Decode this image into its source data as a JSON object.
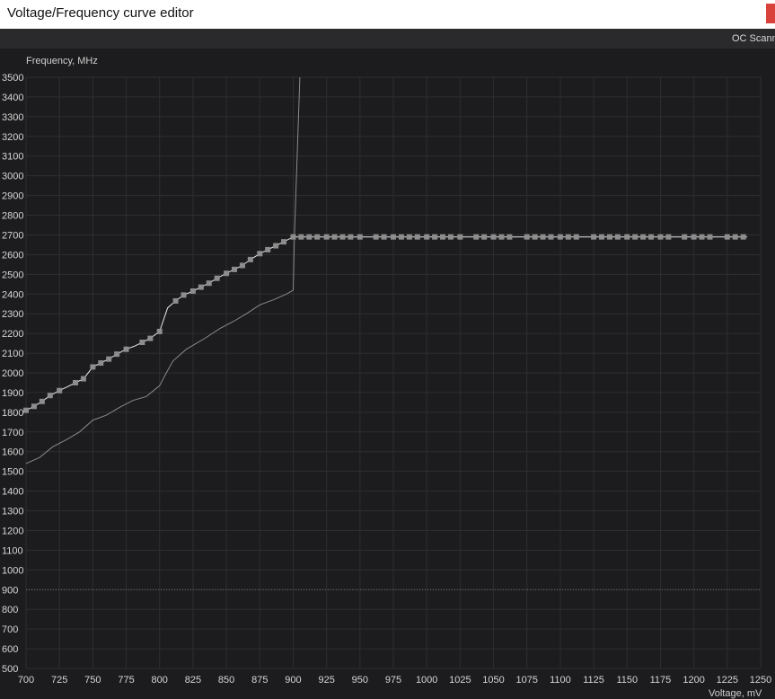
{
  "window": {
    "title": "Voltage/Frequency curve editor",
    "close_icon": "close-icon"
  },
  "toolbar": {
    "oc_scanner_label": "OC Scanner"
  },
  "colors": {
    "background": "#1c1c1e",
    "grid": "#2e2e31",
    "curve": "#e8e8e8",
    "baseline_curve": "#8a8a8a",
    "point": "#8d8d8d",
    "axis_text": "#d6d6d6",
    "close_button": "#d9423b"
  },
  "chart_data": {
    "type": "line",
    "xlabel": "Voltage, mV",
    "ylabel": "Frequency, MHz",
    "xlim": [
      700,
      1250
    ],
    "ylim": [
      500,
      3500
    ],
    "x_ticks": [
      700,
      725,
      750,
      775,
      800,
      825,
      850,
      875,
      900,
      925,
      950,
      975,
      1000,
      1025,
      1050,
      1075,
      1100,
      1125,
      1150,
      1175,
      1200,
      1225,
      1250
    ],
    "y_ticks": [
      500,
      600,
      700,
      800,
      900,
      1000,
      1100,
      1200,
      1300,
      1400,
      1500,
      1600,
      1700,
      1800,
      1900,
      2000,
      2100,
      2200,
      2300,
      2400,
      2500,
      2600,
      2700,
      2800,
      2900,
      3000,
      3100,
      3200,
      3300,
      3400,
      3500
    ],
    "grid": true,
    "reference_line_y": 900,
    "series": [
      {
        "kind": "edited_curve",
        "x": [
          700,
          706,
          712,
          718,
          725,
          731,
          737,
          743,
          750,
          756,
          762,
          768,
          775,
          781,
          787,
          793,
          800,
          806,
          812,
          818,
          825,
          831,
          837,
          843,
          850,
          856,
          862,
          868,
          875,
          881,
          887,
          893,
          900,
          1240
        ],
        "y": [
          1810,
          1830,
          1855,
          1885,
          1910,
          1930,
          1950,
          1970,
          2030,
          2050,
          2070,
          2095,
          2120,
          2135,
          2155,
          2175,
          2210,
          2330,
          2365,
          2395,
          2415,
          2435,
          2455,
          2480,
          2505,
          2525,
          2545,
          2575,
          2605,
          2625,
          2645,
          2665,
          2690,
          2690
        ]
      },
      {
        "kind": "default_curve",
        "x": [
          700,
          710,
          720,
          730,
          740,
          750,
          760,
          770,
          780,
          790,
          800,
          805,
          810,
          815,
          820,
          825,
          835,
          845,
          855,
          865,
          875,
          885,
          895,
          900,
          901,
          903,
          905
        ],
        "y": [
          1540,
          1570,
          1625,
          1660,
          1700,
          1760,
          1785,
          1825,
          1860,
          1880,
          1935,
          2000,
          2060,
          2090,
          2120,
          2140,
          2180,
          2225,
          2260,
          2300,
          2345,
          2370,
          2400,
          2420,
          2700,
          3100,
          3500
        ]
      },
      {
        "kind": "points",
        "x": [
          700,
          706,
          712,
          718,
          725,
          737,
          743,
          750,
          756,
          762,
          768,
          775,
          787,
          793,
          800,
          812,
          818,
          825,
          831,
          837,
          843,
          850,
          856,
          862,
          868,
          875,
          881,
          887,
          893,
          900,
          906,
          912,
          918,
          925,
          931,
          937,
          943,
          950,
          962,
          968,
          975,
          981,
          987,
          993,
          1000,
          1006,
          1012,
          1018,
          1025,
          1037,
          1043,
          1050,
          1056,
          1062,
          1075,
          1081,
          1087,
          1093,
          1100,
          1106,
          1112,
          1125,
          1131,
          1137,
          1143,
          1150,
          1156,
          1162,
          1168,
          1175,
          1181,
          1193,
          1200,
          1206,
          1212,
          1225,
          1231,
          1237
        ],
        "y": [
          1810,
          1830,
          1855,
          1885,
          1910,
          1950,
          1970,
          2030,
          2050,
          2070,
          2095,
          2120,
          2155,
          2175,
          2210,
          2365,
          2395,
          2415,
          2435,
          2455,
          2480,
          2505,
          2525,
          2545,
          2575,
          2605,
          2625,
          2645,
          2665,
          2690,
          2690,
          2690,
          2690,
          2690,
          2690,
          2690,
          2690,
          2690,
          2690,
          2690,
          2690,
          2690,
          2690,
          2690,
          2690,
          2690,
          2690,
          2690,
          2690,
          2690,
          2690,
          2690,
          2690,
          2690,
          2690,
          2690,
          2690,
          2690,
          2690,
          2690,
          2690,
          2690,
          2690,
          2690,
          2690,
          2690,
          2690,
          2690,
          2690,
          2690,
          2690,
          2690,
          2690,
          2690,
          2690,
          2690,
          2690,
          2690
        ]
      }
    ]
  }
}
